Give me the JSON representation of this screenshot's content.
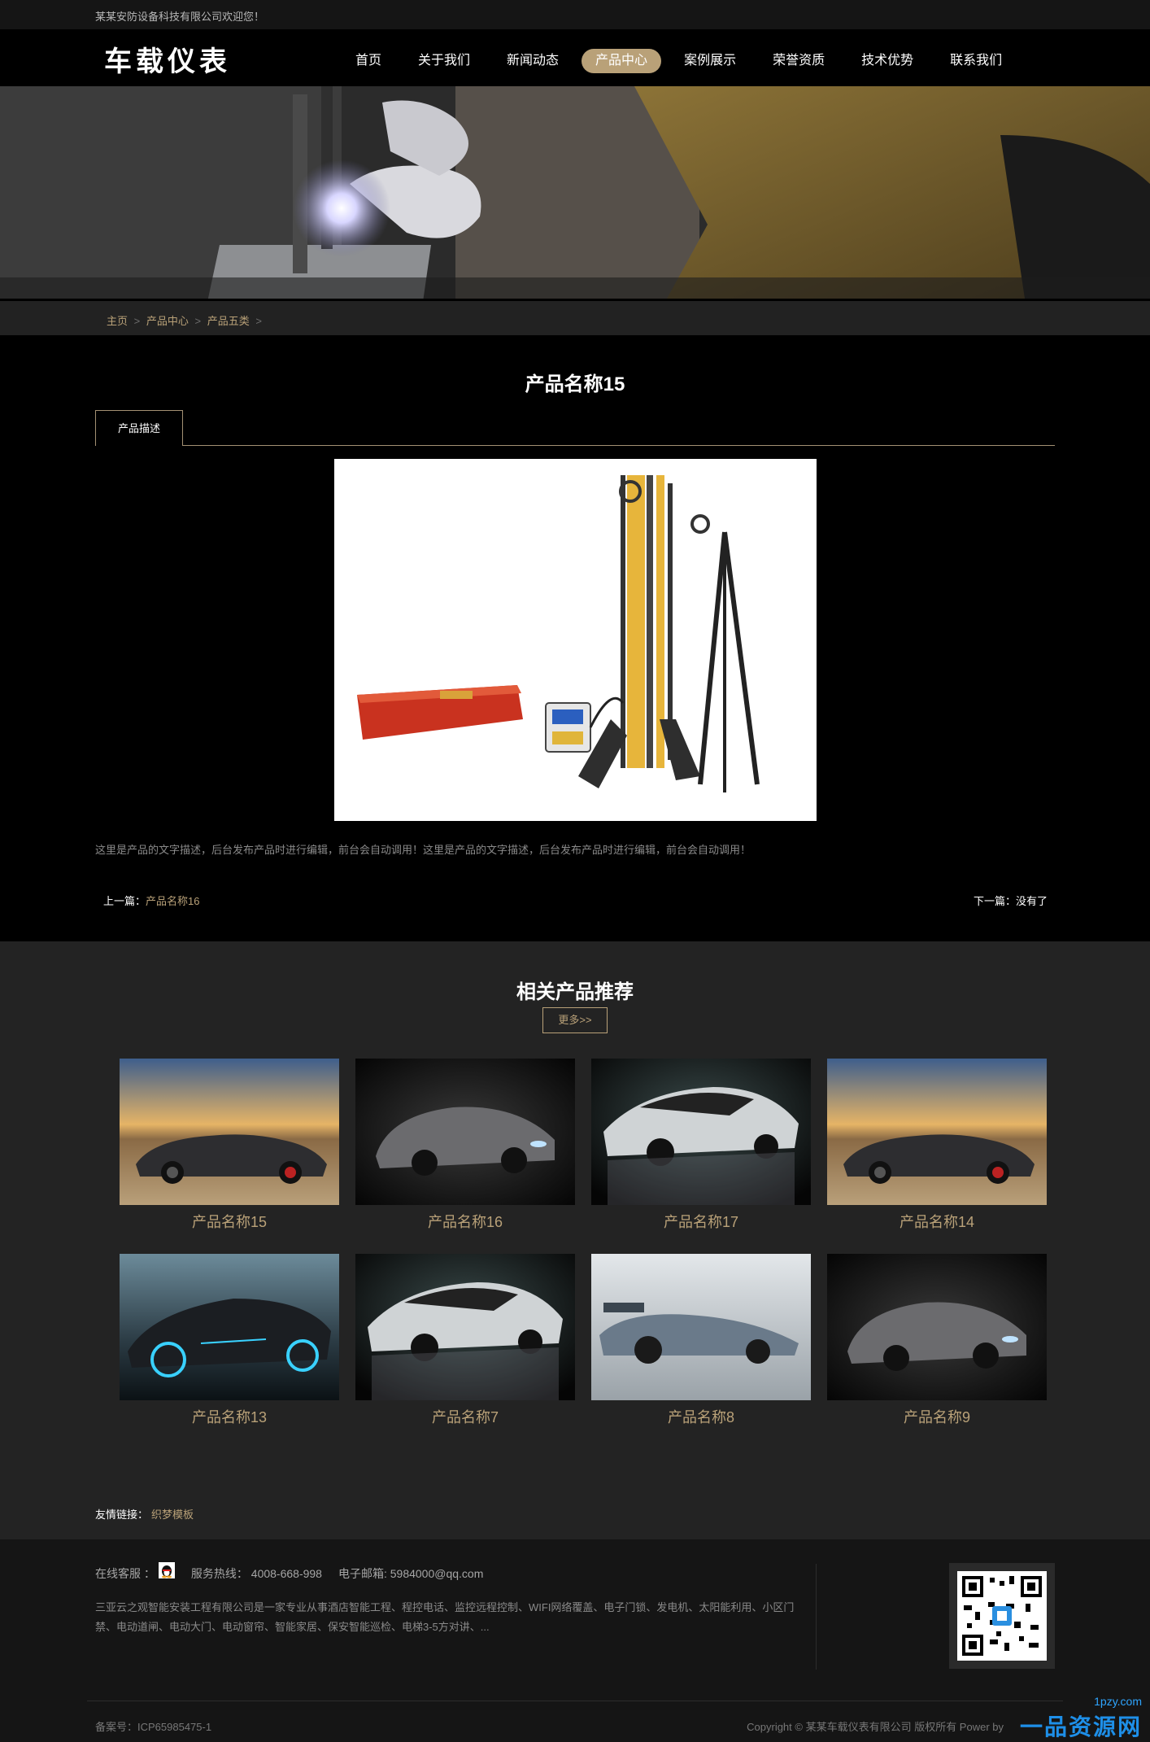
{
  "topbar": {
    "welcome": "某某安防设备科技有限公司欢迎您！"
  },
  "header": {
    "logo": "车载仪表",
    "nav": [
      {
        "label": "首页",
        "active": false
      },
      {
        "label": "关于我们",
        "active": false
      },
      {
        "label": "新闻动态",
        "active": false
      },
      {
        "label": "产品中心",
        "active": true
      },
      {
        "label": "案例展示",
        "active": false
      },
      {
        "label": "荣誉资质",
        "active": false
      },
      {
        "label": "技术优势",
        "active": false
      },
      {
        "label": "联系我们",
        "active": false
      }
    ]
  },
  "breadcrumb": {
    "home": "主页",
    "level1": "产品中心",
    "level2": "产品五类",
    "sep": ">"
  },
  "product": {
    "title": "产品名称15",
    "tab": "产品描述",
    "description": "这里是产品的文字描述，后台发布产品时进行编辑，前台会自动调用！这里是产品的文字描述，后台发布产品时进行编辑，前台会自动调用！",
    "prev_label": "上一篇：",
    "prev_value": "产品名称16",
    "next_label": "下一篇：",
    "next_value": "没有了"
  },
  "related": {
    "title": "相关产品推荐",
    "more": "更多>>",
    "items": [
      {
        "name": "产品名称15"
      },
      {
        "name": "产品名称16"
      },
      {
        "name": "产品名称17"
      },
      {
        "name": "产品名称14"
      },
      {
        "name": "产品名称13"
      },
      {
        "name": "产品名称7"
      },
      {
        "name": "产品名称8"
      },
      {
        "name": "产品名称9"
      }
    ],
    "friend_links_label": "友情链接：",
    "friend_links": [
      "织梦模板"
    ]
  },
  "footer": {
    "online_service": "在线客服 ：",
    "hotline": "服务热线： 4008-668-998",
    "email": "电子邮箱: 5984000@qq.com",
    "about": "三亚云之观智能安装工程有限公司是一家专业从事酒店智能工程、程控电话、监控远程控制、WIFI网络覆盖、电子门锁、发电机、太阳能利用、小区门禁、电动道闸、电动大门、电动窗帘、智能家居、保安智能巡检、电梯3-5方对讲、...",
    "icp": "备案号：ICP65985475-1",
    "copyright": "Copyright © 某某车载仪表有限公司 版权所有 Power by",
    "watermark_url": "1pzy.com",
    "watermark_text": "一品资源网"
  },
  "colors": {
    "accent": "#b9a178",
    "background": "#000000",
    "panel": "#232323"
  }
}
